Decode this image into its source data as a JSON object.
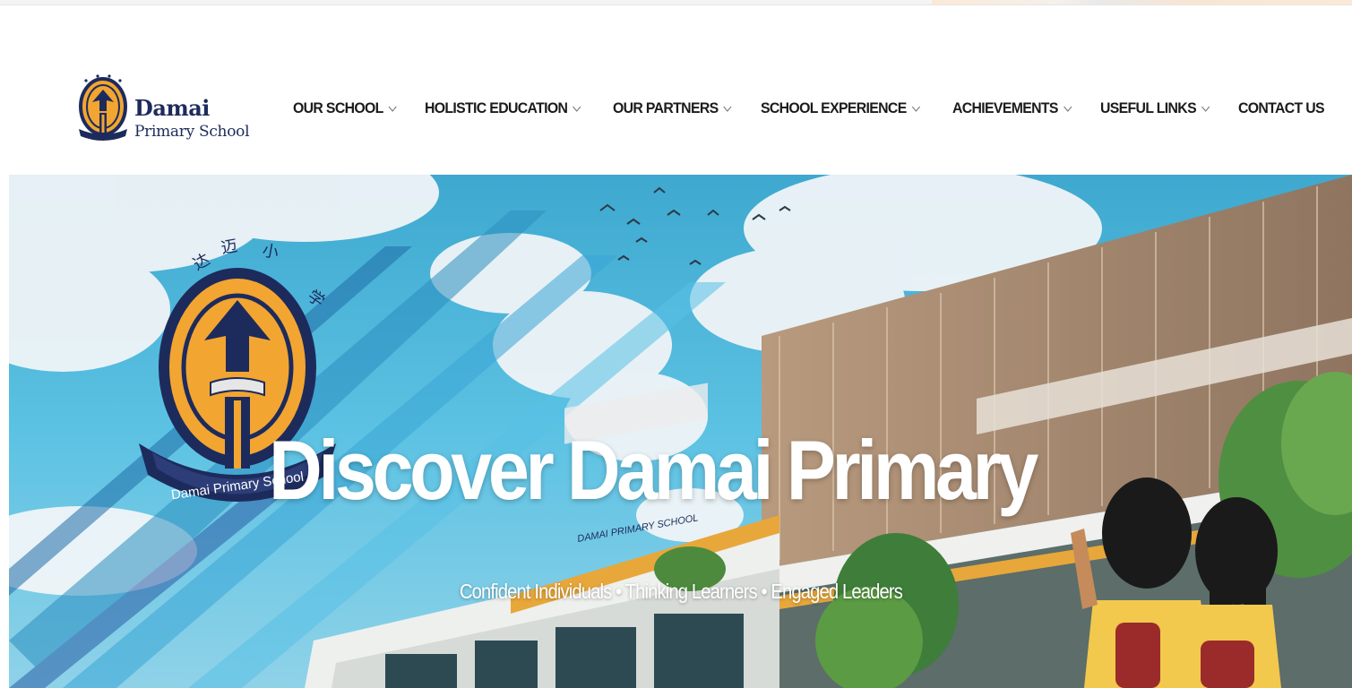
{
  "brand": {
    "name_line1": "Damai",
    "name_line2": "Primary School",
    "primary_color": "#1d2b5c",
    "accent_color": "#f2a531"
  },
  "nav": {
    "items": [
      {
        "label": "OUR SCHOOL",
        "has_dropdown": true,
        "icon": "chevron-down-icon"
      },
      {
        "label": "HOLISTIC EDUCATION",
        "has_dropdown": true,
        "icon": "chevron-down-icon"
      },
      {
        "label": "OUR PARTNERS",
        "has_dropdown": true,
        "icon": "chevron-down-icon"
      },
      {
        "label": "SCHOOL EXPERIENCE",
        "has_dropdown": true,
        "icon": "chevron-down-icon"
      },
      {
        "label": "ACHIEVEMENTS",
        "has_dropdown": true,
        "icon": "chevron-down-icon"
      },
      {
        "label": "USEFUL LINKS",
        "has_dropdown": true,
        "icon": "chevron-down-icon"
      },
      {
        "label": "CONTACT US",
        "has_dropdown": false
      }
    ]
  },
  "hero": {
    "title": "Discover Damai Primary",
    "subtitle": "Confident Individuals • Thinking Learners • Engaged Leaders",
    "crest_banner_text": "Damai Primary School",
    "building_sign_text": "DAMAI PRIMARY SCHOOL",
    "crest_chinese_text": "达迈小学"
  }
}
